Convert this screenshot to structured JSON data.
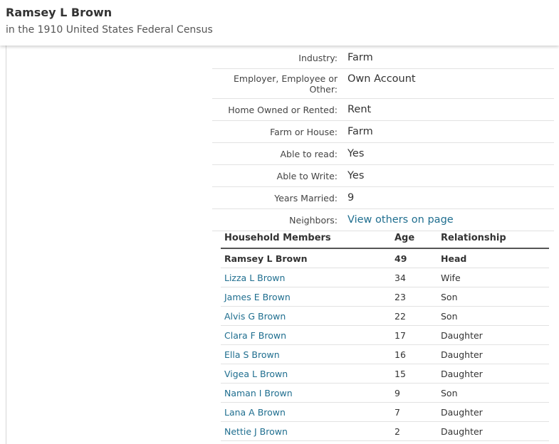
{
  "header": {
    "title": "Ramsey L Brown",
    "subtitle": "in the 1910 United States Federal Census"
  },
  "details": [
    {
      "label": "Industry:",
      "value": "Farm",
      "link": false
    },
    {
      "label": "Employer, Employee or Other:",
      "value": "Own Account",
      "link": false
    },
    {
      "label": "Home Owned or Rented:",
      "value": "Rent",
      "link": false
    },
    {
      "label": "Farm or House:",
      "value": "Farm",
      "link": false
    },
    {
      "label": "Able to read:",
      "value": "Yes",
      "link": false
    },
    {
      "label": "Able to Write:",
      "value": "Yes",
      "link": false
    },
    {
      "label": "Years Married:",
      "value": "9",
      "link": false
    },
    {
      "label": "Neighbors:",
      "value": "View others on page",
      "link": true
    }
  ],
  "household": {
    "headers": {
      "name": "Household Members",
      "age": "Age",
      "relationship": "Relationship"
    },
    "members": [
      {
        "name": "Ramsey L Brown",
        "age": "49",
        "relationship": "Head",
        "self": true
      },
      {
        "name": "Lizza L Brown",
        "age": "34",
        "relationship": "Wife",
        "self": false
      },
      {
        "name": "James E Brown",
        "age": "23",
        "relationship": "Son",
        "self": false
      },
      {
        "name": "Alvis G Brown",
        "age": "22",
        "relationship": "Son",
        "self": false
      },
      {
        "name": "Clara F Brown",
        "age": "17",
        "relationship": "Daughter",
        "self": false
      },
      {
        "name": "Ella S Brown",
        "age": "16",
        "relationship": "Daughter",
        "self": false
      },
      {
        "name": "Vigea L Brown",
        "age": "15",
        "relationship": "Daughter",
        "self": false
      },
      {
        "name": "Naman I Brown",
        "age": "9",
        "relationship": "Son",
        "self": false
      },
      {
        "name": "Lana A Brown",
        "age": "7",
        "relationship": "Daughter",
        "self": false
      },
      {
        "name": "Nettie J Brown",
        "age": "2",
        "relationship": "Daughter",
        "self": false
      }
    ]
  }
}
